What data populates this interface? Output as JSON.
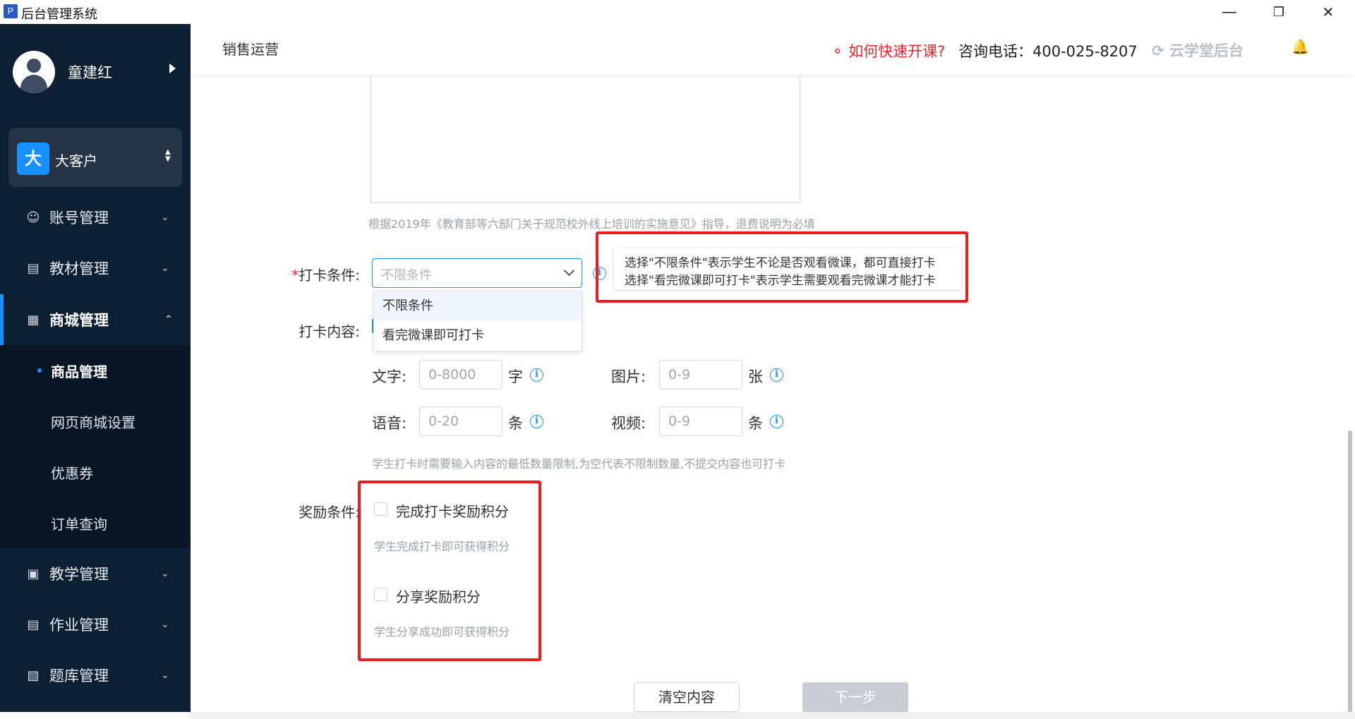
{
  "window": {
    "app_icon_letter": "P",
    "title": "后台管理系统",
    "minimize": "—",
    "restore": "❐",
    "close": "✕"
  },
  "sidebar": {
    "user_name": "童建红",
    "org_badge": "大",
    "org_name": "大客户",
    "items": [
      {
        "label": "账号管理",
        "icon": "user-icon"
      },
      {
        "label": "教材管理",
        "icon": "book-icon"
      },
      {
        "label": "商城管理",
        "icon": "shop-icon"
      },
      {
        "label": "教学管理",
        "icon": "teaching-icon"
      },
      {
        "label": "作业管理",
        "icon": "homework-icon"
      },
      {
        "label": "题库管理",
        "icon": "question-bank-icon"
      }
    ],
    "submenu": [
      {
        "label": "商品管理"
      },
      {
        "label": "网页商城设置"
      },
      {
        "label": "优惠券"
      },
      {
        "label": "订单查询"
      }
    ]
  },
  "header": {
    "title": "销售运营",
    "help_link": "如何快速开课?",
    "phone": "咨询电话：400-025-8207",
    "brand": "云学堂后台"
  },
  "form": {
    "refund_hint": "根据2019年《教育部等六部门关于规范校外线上培训的实施意见》指导，退费说明为必填",
    "checkin_condition_label": "打卡条件:",
    "checkin_condition_required": "*",
    "checkin_condition_placeholder": "不限条件",
    "checkin_condition_options": [
      "不限条件",
      "看完微课即可打卡"
    ],
    "tooltip_line1": "选择\"不限条件\"表示学生不论是否观看微课，都可直接打卡",
    "tooltip_line2": "选择\"看完微课即可打卡\"表示学生需要观看完微课才能打卡",
    "checkin_content_label": "打卡内容:",
    "text_label": "文字:",
    "text_placeholder": "0-8000",
    "text_unit": "字",
    "image_label": "图片:",
    "image_placeholder": "0-9",
    "image_unit": "张",
    "voice_label": "语音:",
    "voice_placeholder": "0-20",
    "voice_unit": "条",
    "video_label": "视频:",
    "video_placeholder": "0-9",
    "video_unit": "条",
    "content_hint": "学生打卡时需要输入内容的最低数量限制,为空代表不限制数量,不提交内容也可打卡",
    "reward_label": "奖励条件:",
    "reward_checkin_label": "完成打卡奖励积分",
    "reward_checkin_hint": "学生完成打卡即可获得积分",
    "reward_share_label": "分享奖励积分",
    "reward_share_hint": "学生分享成功即可获得积分",
    "clear_button": "清空内容",
    "next_button": "下一步"
  },
  "colors": {
    "sidebar_bg": "#0d1f33",
    "accent": "#1890ff",
    "highlight": "#ee1c1c"
  }
}
